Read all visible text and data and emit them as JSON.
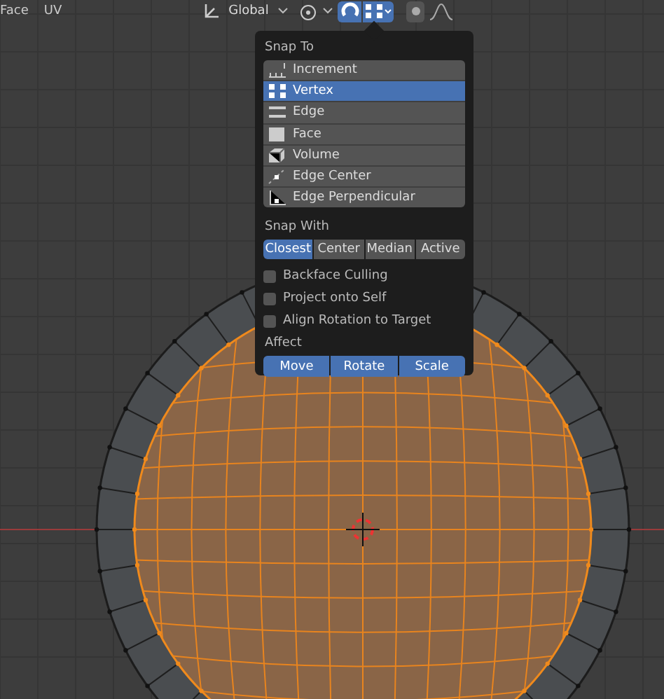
{
  "header": {
    "menus": [
      "Face",
      "UV"
    ],
    "orientation": "Global",
    "snap_on": true,
    "proportional_on": false
  },
  "snap_popover": {
    "snap_to_title": "Snap To",
    "snap_to": [
      {
        "label": "Increment",
        "kind": "increment",
        "selected": false
      },
      {
        "label": "Vertex",
        "kind": "vertex",
        "selected": true
      },
      {
        "label": "Edge",
        "kind": "edge",
        "selected": false
      },
      {
        "label": "Face",
        "kind": "face",
        "selected": false
      },
      {
        "label": "Volume",
        "kind": "volume",
        "selected": false
      },
      {
        "label": "Edge Center",
        "kind": "edge_center",
        "selected": false
      },
      {
        "label": "Edge Perpendicular",
        "kind": "edge_perpendicular",
        "selected": false
      }
    ],
    "snap_with_title": "Snap With",
    "snap_with": [
      {
        "label": "Closest",
        "selected": true
      },
      {
        "label": "Center",
        "selected": false
      },
      {
        "label": "Median",
        "selected": false
      },
      {
        "label": "Active",
        "selected": false
      }
    ],
    "options": [
      {
        "label": "Backface Culling",
        "checked": false
      },
      {
        "label": "Project onto Self",
        "checked": false
      },
      {
        "label": "Align Rotation to Target",
        "checked": false
      }
    ],
    "affect_title": "Affect",
    "affect": [
      {
        "label": "Move",
        "selected": true
      },
      {
        "label": "Rotate",
        "selected": true
      },
      {
        "label": "Scale",
        "selected": true
      }
    ]
  }
}
